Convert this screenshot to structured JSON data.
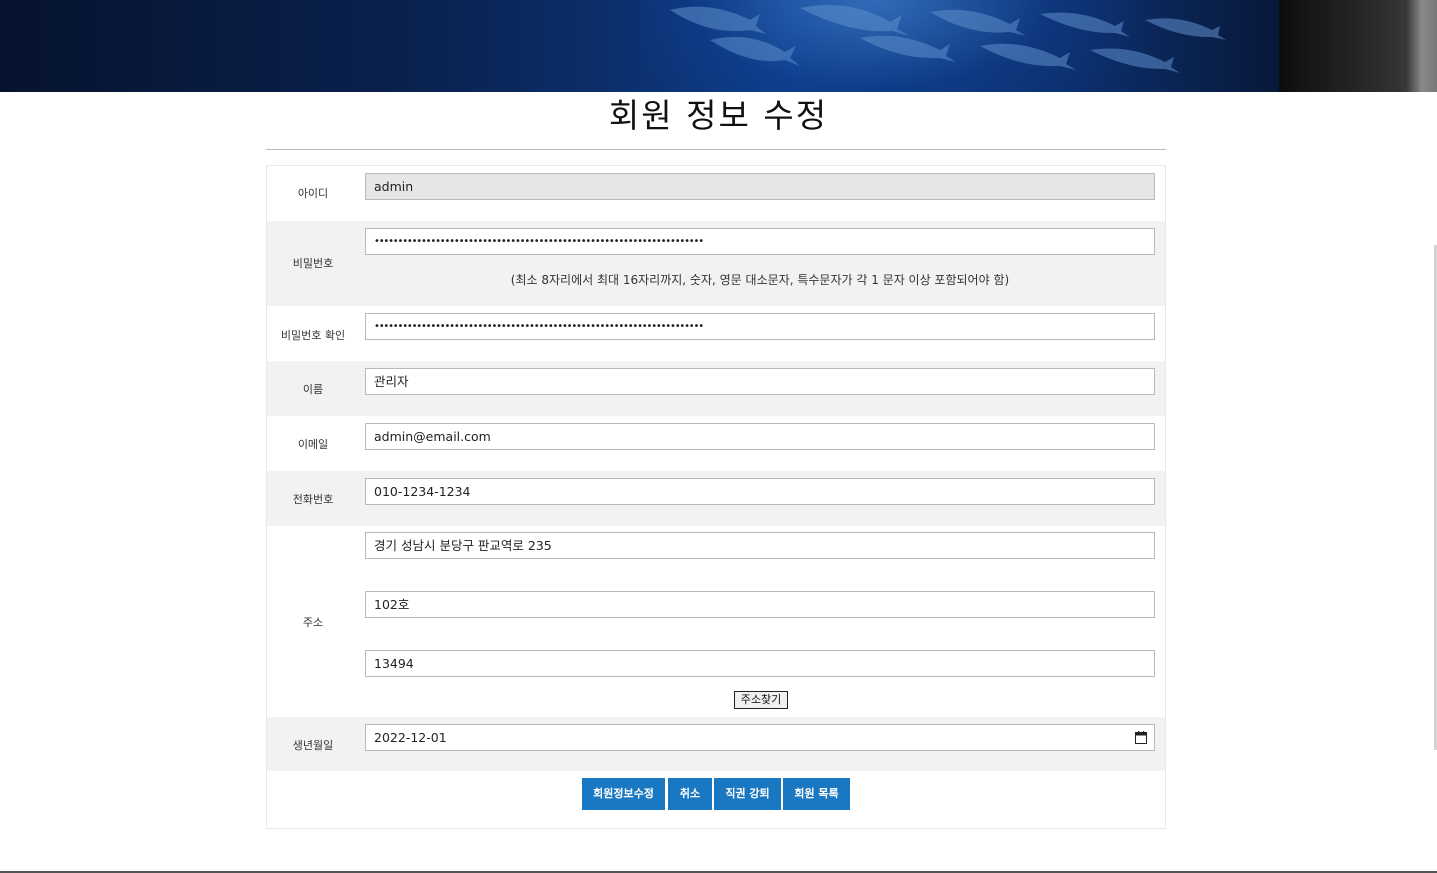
{
  "page": {
    "title": "회원 정보 수정"
  },
  "form": {
    "id": {
      "label": "아이디",
      "value": "admin"
    },
    "password": {
      "label": "비밀번호",
      "value": "••••••••••••••••••••••••••••••••••••••••••••••••••••••••••••••••••••••",
      "hint": "(최소 8자리에서 최대 16자리까지, 숫자, 영문 대소문자, 특수문자가 각 1 문자 이상 포함되어야 함)"
    },
    "password_confirm": {
      "label": "비밀번호 확인",
      "value": "••••••••••••••••••••••••••••••••••••••••••••••••••••••••••••••••••••••"
    },
    "name": {
      "label": "이름",
      "value": "관리자"
    },
    "email": {
      "label": "이메일",
      "value": "admin@email.com"
    },
    "phone": {
      "label": "전화번호",
      "value": "010-1234-1234"
    },
    "address": {
      "label": "주소",
      "line1": "경기 성남시 분당구 판교역로 235",
      "line2": "102호",
      "zipcode": "13494",
      "find_button": "주소찾기"
    },
    "birthdate": {
      "label": "생년월일",
      "value": "2022-12-01"
    }
  },
  "actions": {
    "update": "회원정보수정",
    "cancel": "취소",
    "demote": "직권 강퇴",
    "member_list": "회원 목록"
  },
  "colors": {
    "button": "#1a78c2",
    "readonly_bg": "#e6e6e6",
    "alt_row": "#f2f2f2"
  }
}
